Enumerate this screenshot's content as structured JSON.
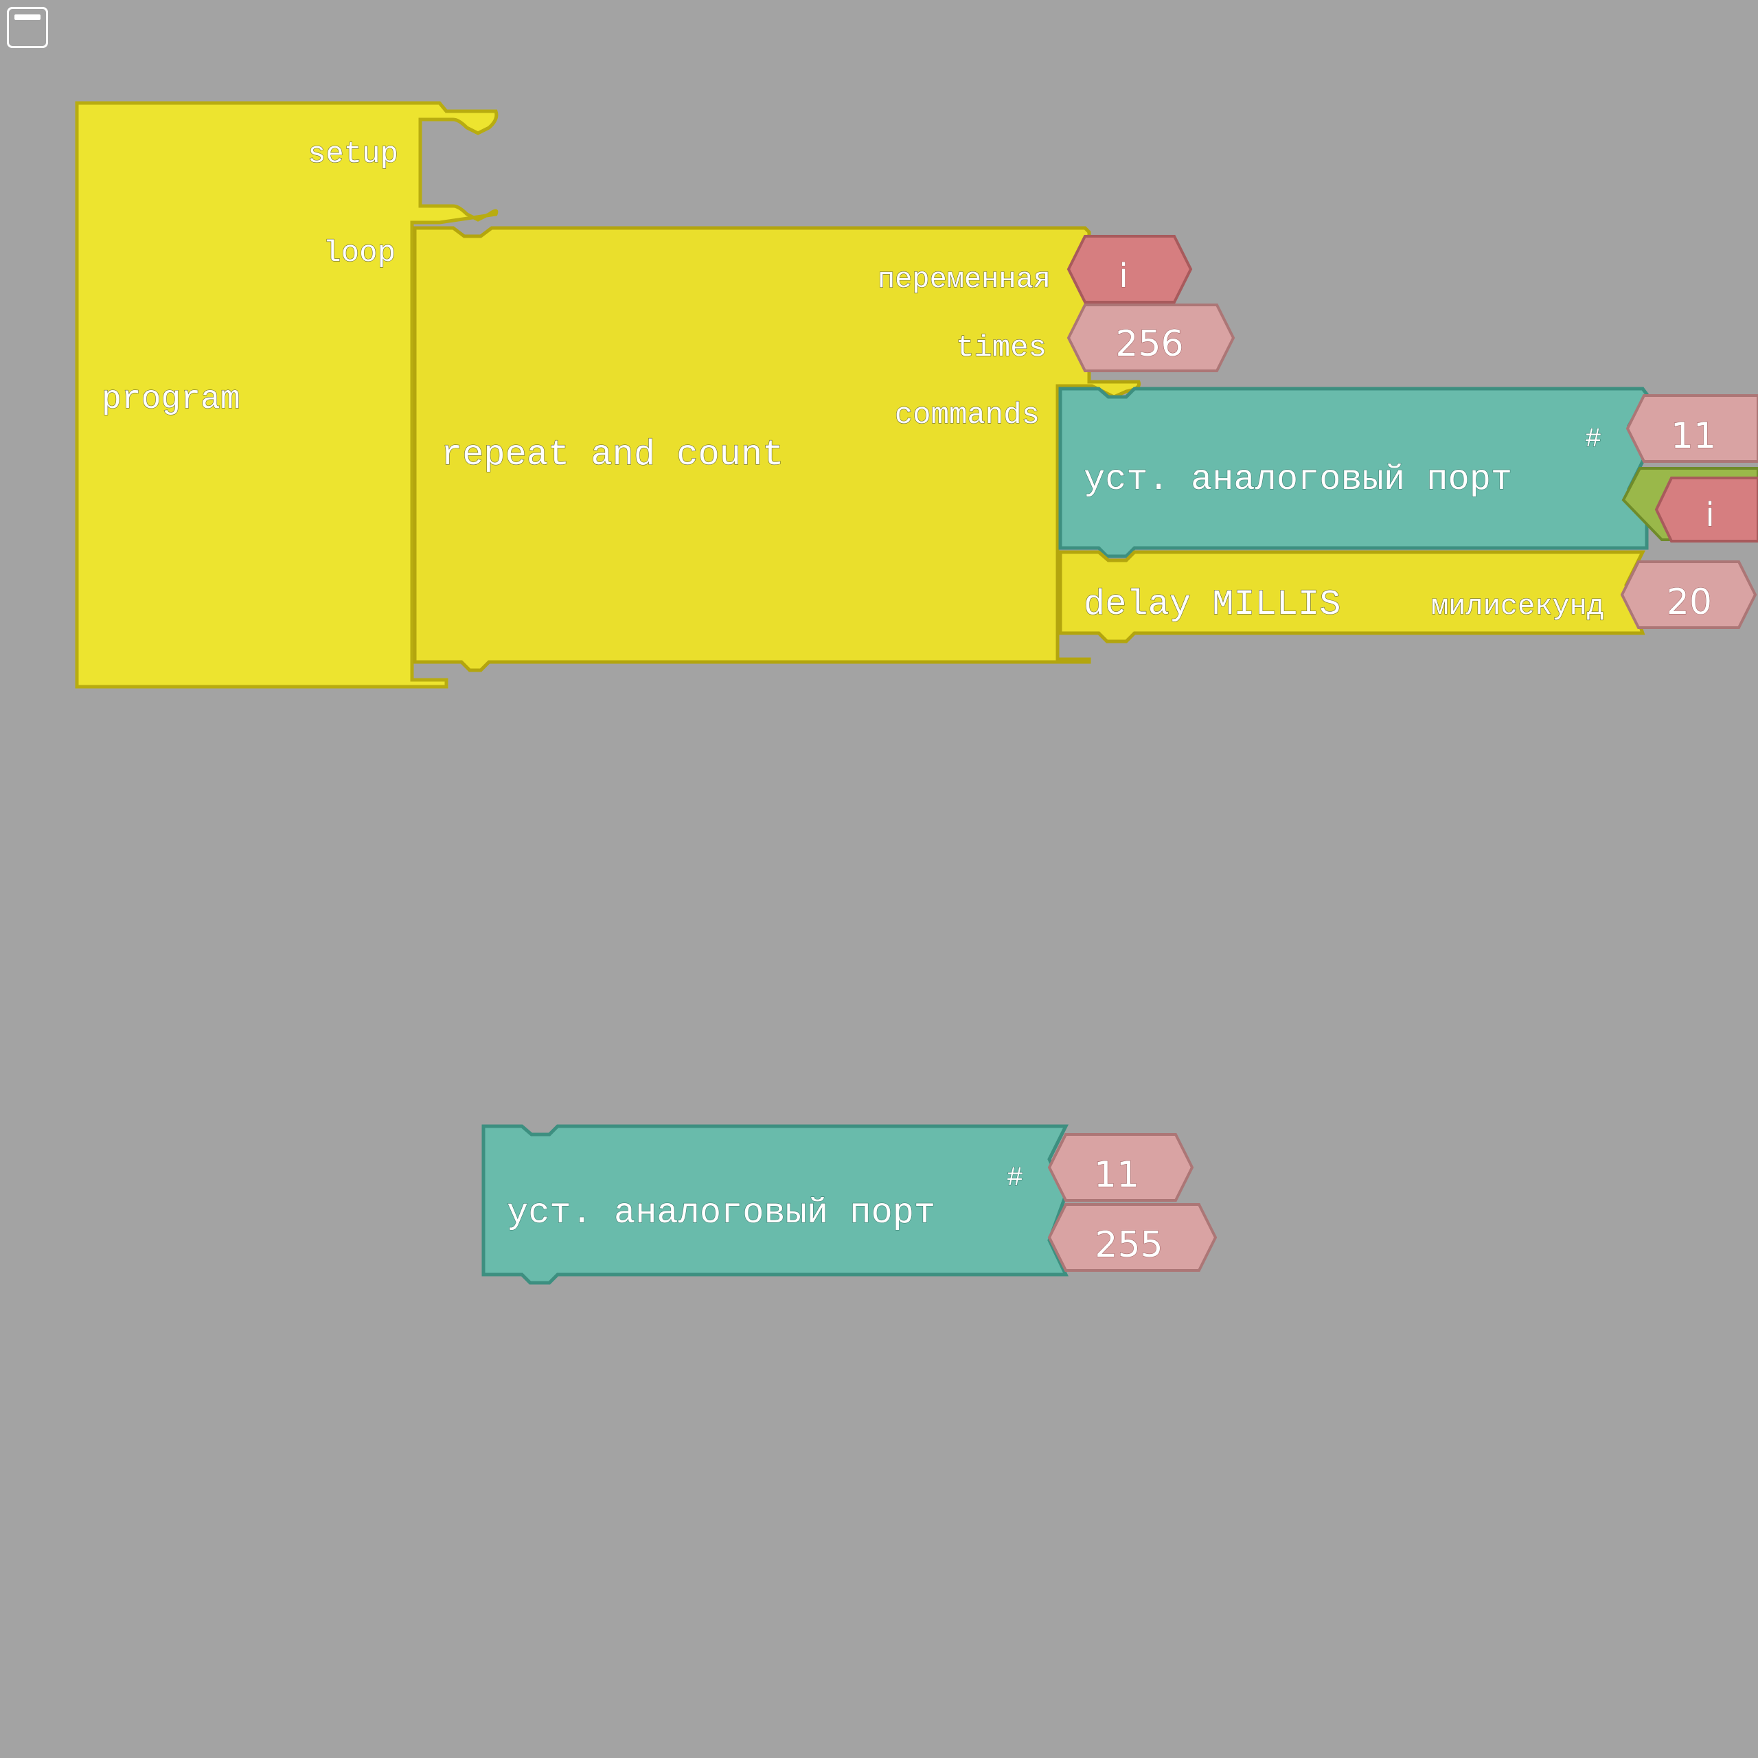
{
  "colors": {
    "background": "#a3a3a3",
    "control_block": "#eadf2c",
    "program_block": "#ede42f",
    "io_block": "#69bbab",
    "number_input": "#d9a3a3",
    "variable_input": "#d67e80",
    "boolean_plug": "#9ab84a"
  },
  "toolbar": {
    "window_icon": "window-icon"
  },
  "program_block": {
    "title": "program",
    "setup_label": "setup",
    "loop_label": "loop"
  },
  "repeat_block": {
    "title": "repeat and count",
    "variable_label": "переменная",
    "variable_value": "i",
    "times_label": "times",
    "times_value": "256",
    "commands_label": "commands"
  },
  "analog_write_block": {
    "title": "уст. аналоговый порт",
    "pin_label": "#",
    "pin_value": "11",
    "value": "i"
  },
  "delay_block": {
    "title": "delay MILLIS",
    "unit_label": "милисекунд",
    "value": "20"
  },
  "loose_analog_write_block": {
    "title": "уст. аналоговый порт",
    "pin_label": "#",
    "pin_value": "11",
    "value": "255"
  }
}
